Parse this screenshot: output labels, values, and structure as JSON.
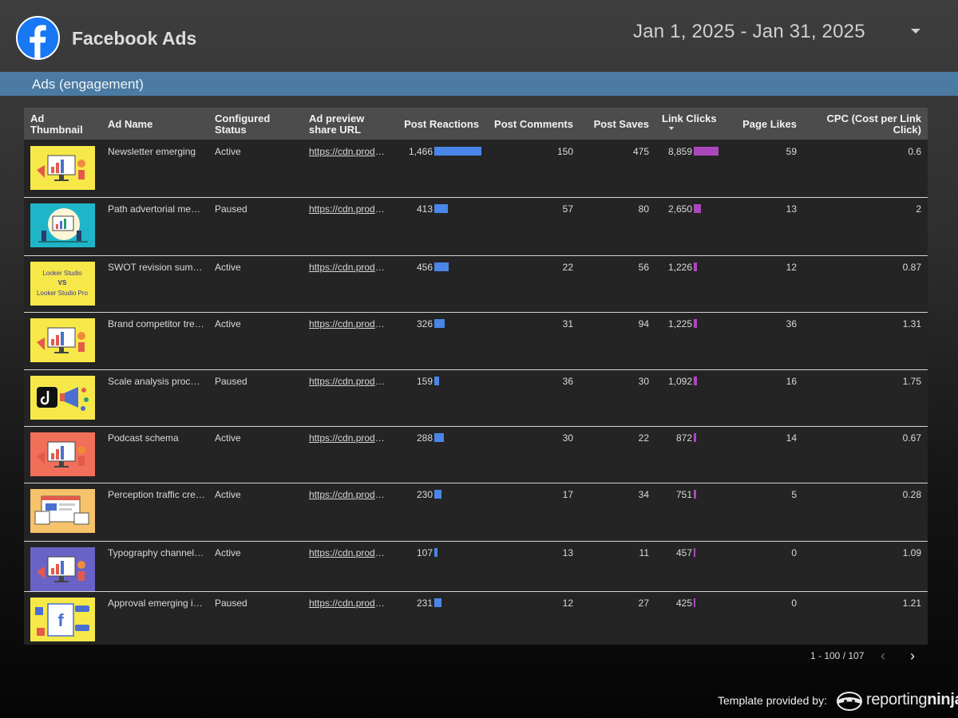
{
  "app": {
    "title": "Facebook Ads",
    "logo_icon": "facebook-logo-icon",
    "brand_color": "#1877f2"
  },
  "date_range": {
    "value": "Jan 1, 2025 - Jan 31, 2025"
  },
  "section": {
    "title": "Ads (engagement)",
    "color": "#4b7aa3"
  },
  "table": {
    "columns": [
      "Ad Thumbnail",
      "Ad Name",
      "Configured Status",
      "Ad preview share URL",
      "Post Reactions",
      "Post Comments",
      "Post Saves",
      "Link Clicks",
      "Page Likes",
      "CPC (Cost per Link Click)"
    ],
    "sorted_by": "Link Clicks",
    "sort_direction": "descending",
    "bar_colors": {
      "post_reactions": "#4a86e8",
      "link_clicks": "#ab47bc"
    },
    "rows": [
      {
        "thumb_bg": "#f7e84a",
        "thumb_icon": "megaphone-illustration-icon",
        "name": "Newsletter emerging",
        "status": "Active",
        "url": "https://cdn.prod.website-files.com",
        "reactions": "1,466",
        "reactions_value": 1466,
        "comments": "150",
        "saves": "475",
        "clicks": "8,859",
        "clicks_value": 8859,
        "likes": "59",
        "cpc": "0.6"
      },
      {
        "thumb_bg": "#1fb5c9",
        "thumb_icon": "analytics-presentation-icon",
        "name": "Path advertorial messaging",
        "status": "Paused",
        "url": "https://cdn.prod.website-files.com",
        "reactions": "413",
        "reactions_value": 413,
        "comments": "57",
        "saves": "80",
        "clicks": "2,650",
        "clicks_value": 2650,
        "likes": "13",
        "cpc": "2"
      },
      {
        "thumb_bg": "#f7e84a",
        "thumb_icon": "looker-studio-comparison-icon",
        "thumb_text_a": "Looker Studio",
        "thumb_text_vs": "VS",
        "thumb_text_b": "Looker Studio Pro",
        "name": "SWOT revision summary",
        "status": "Active",
        "url": "https://cdn.prod.website-files.com",
        "reactions": "456",
        "reactions_value": 456,
        "comments": "22",
        "saves": "56",
        "clicks": "1,226",
        "clicks_value": 1226,
        "likes": "12",
        "cpc": "0.87"
      },
      {
        "thumb_bg": "#f7e84a",
        "thumb_icon": "megaphone-illustration-icon",
        "name": "Brand competitor trends",
        "status": "Active",
        "url": "https://cdn.prod.website-files.com",
        "reactions": "326",
        "reactions_value": 326,
        "comments": "31",
        "saves": "94",
        "clicks": "1,225",
        "clicks_value": 1225,
        "likes": "36",
        "cpc": "1.31"
      },
      {
        "thumb_bg": "#f7e84a",
        "thumb_icon": "tiktok-megaphone-icon",
        "name": "Scale analysis process",
        "status": "Paused",
        "url": "https://cdn.prod.website-files.com",
        "reactions": "159",
        "reactions_value": 159,
        "comments": "36",
        "saves": "30",
        "clicks": "1,092",
        "clicks_value": 1092,
        "likes": "16",
        "cpc": "1.75"
      },
      {
        "thumb_bg": "#f0705a",
        "thumb_icon": "dashboard-illustration-icon",
        "name": "Podcast schema",
        "status": "Active",
        "url": "https://cdn.prod.website-files.com",
        "reactions": "288",
        "reactions_value": 288,
        "comments": "30",
        "saves": "22",
        "clicks": "872",
        "clicks_value": 872,
        "likes": "14",
        "cpc": "0.67"
      },
      {
        "thumb_bg": "#f6c36b",
        "thumb_icon": "web-report-illustration-icon",
        "name": "Perception traffic creative",
        "status": "Active",
        "url": "https://cdn.prod.website-files.com",
        "reactions": "230",
        "reactions_value": 230,
        "comments": "17",
        "saves": "34",
        "clicks": "751",
        "clicks_value": 751,
        "likes": "5",
        "cpc": "0.28"
      },
      {
        "thumb_bg": "#6a63c7",
        "thumb_icon": "dashboard-illustration-icon",
        "name": "Typography channel report",
        "status": "Active",
        "url": "https://cdn.prod.website-files.com",
        "reactions": "107",
        "reactions_value": 107,
        "comments": "13",
        "saves": "11",
        "clicks": "457",
        "clicks_value": 457,
        "likes": "0",
        "cpc": "1.09"
      },
      {
        "thumb_bg": "#f7e84a",
        "thumb_icon": "facebook-page-illustration-icon",
        "name": "Approval emerging insights",
        "status": "Paused",
        "url": "https://cdn.prod.website-files.com",
        "reactions": "231",
        "reactions_value": 231,
        "comments": "12",
        "saves": "27",
        "clicks": "425",
        "clicks_value": 425,
        "likes": "0",
        "cpc": "1.21"
      }
    ]
  },
  "pagination": {
    "label": "1 - 100 / 107",
    "prev_icon": "chevron-left-icon",
    "next_icon": "chevron-right-icon"
  },
  "footer": {
    "label": "Template provided by:",
    "brand_a": "reporting",
    "brand_b": "ninja",
    "brand_icon": "ninja-mask-icon"
  }
}
